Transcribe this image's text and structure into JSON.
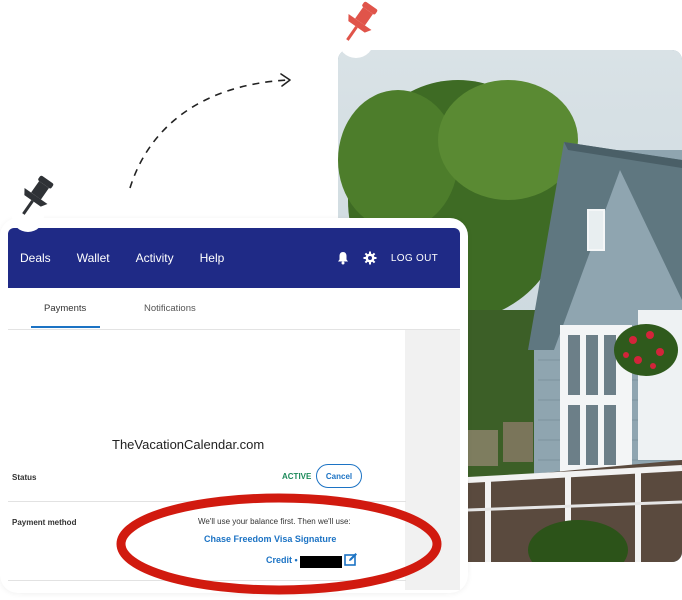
{
  "nav": {
    "items": [
      "Deals",
      "Wallet",
      "Activity",
      "Help"
    ],
    "logout_label": "LOG OUT"
  },
  "tabs": {
    "payments_label": "Payments",
    "notifications_label": "Notifications"
  },
  "watermark": "TheVacationCalendar.com",
  "status": {
    "label": "Status",
    "value": "ACTIVE",
    "cancel_label": "Cancel"
  },
  "payment": {
    "label": "Payment method",
    "balance_text": "We'll use your balance first. Then we'll use:",
    "card_name": "Chase Freedom Visa Signature",
    "credit_label": "Credit •"
  },
  "colors": {
    "nav_bg": "#1f2a86",
    "accent_blue": "#1c73c4",
    "active_green": "#1c8a5a",
    "pin_red": "#e0544a",
    "pin_dark": "#2f3236",
    "ellipse_red": "#d11a0f"
  },
  "icons": {
    "notification": "bell-icon",
    "settings": "gear-icon",
    "edit": "edit-icon"
  }
}
